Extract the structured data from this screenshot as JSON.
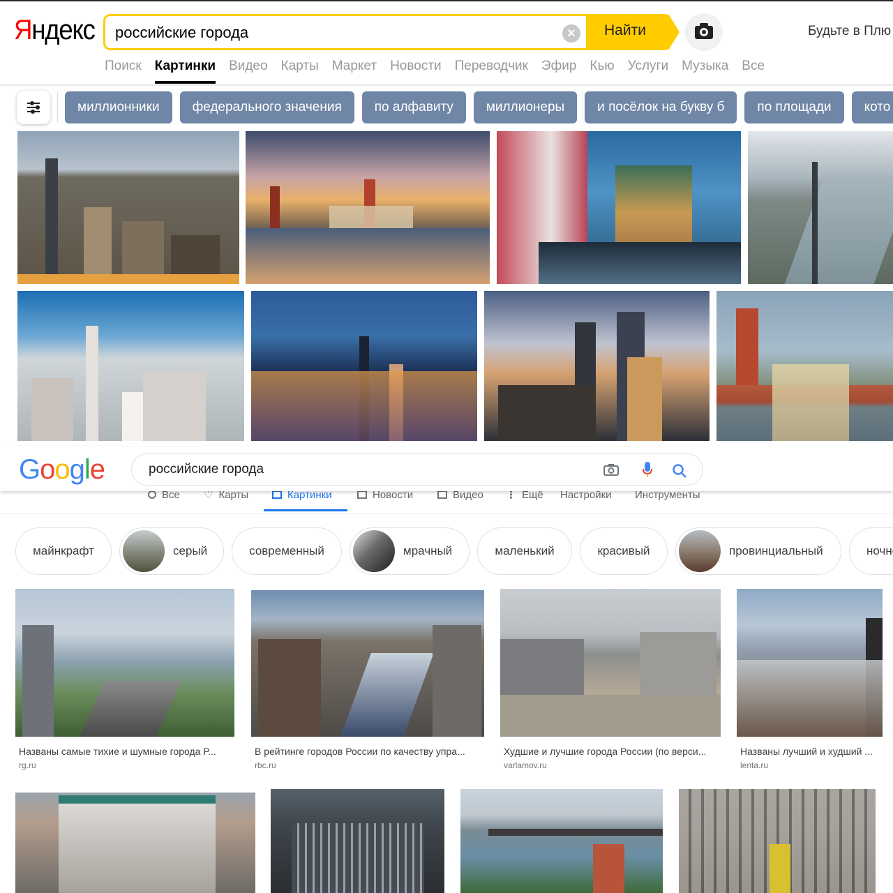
{
  "yandex": {
    "logo": "Яндекс",
    "logo_first": "Я",
    "logo_rest": "ндекс",
    "search_value": "российские города",
    "clear_glyph": "×",
    "find_button": "Найти",
    "plus_text": "Будьте в Плю",
    "nav": [
      "Поиск",
      "Картинки",
      "Видео",
      "Карты",
      "Маркет",
      "Новости",
      "Переводчик",
      "Эфир",
      "Кью",
      "Услуги",
      "Музыка",
      "Все"
    ],
    "nav_active": "Картинки",
    "chips": [
      "миллионники",
      "федерального значения",
      "по алфавиту",
      "миллионеры",
      "и посёлок на букву б",
      "по площади",
      "кото"
    ],
    "accent": "#ffcc00",
    "chip_color": "#6f86a6"
  },
  "google": {
    "logo_letters": [
      "G",
      "o",
      "o",
      "g",
      "l",
      "e"
    ],
    "logo_colors": [
      "#4285f4",
      "#ea4335",
      "#fbbc05",
      "#4285f4",
      "#34a853",
      "#ea4335"
    ],
    "search_value": "российские города",
    "nav": {
      "all": "Все",
      "maps": "Карты",
      "images": "Картинки",
      "news": "Новости",
      "video": "Видео",
      "more": "Ещё",
      "settings": "Настройки",
      "tools": "Инструменты"
    },
    "chips": [
      "майнкрафт",
      "серый",
      "современный",
      "мрачный",
      "маленький",
      "красивый",
      "провинциальный",
      "ночно"
    ],
    "results": [
      {
        "caption": "Названы самые тихие и шумные города Р...",
        "source": "rg.ru"
      },
      {
        "caption": "В рейтинге городов России по качеству упра...",
        "source": "rbc.ru"
      },
      {
        "caption": "Худшие и лучшие города России (по верси...",
        "source": "varlamov.ru"
      },
      {
        "caption": "Названы лучший и худший ...",
        "source": "lenta.ru"
      }
    ],
    "accent": "#1a73e8"
  }
}
